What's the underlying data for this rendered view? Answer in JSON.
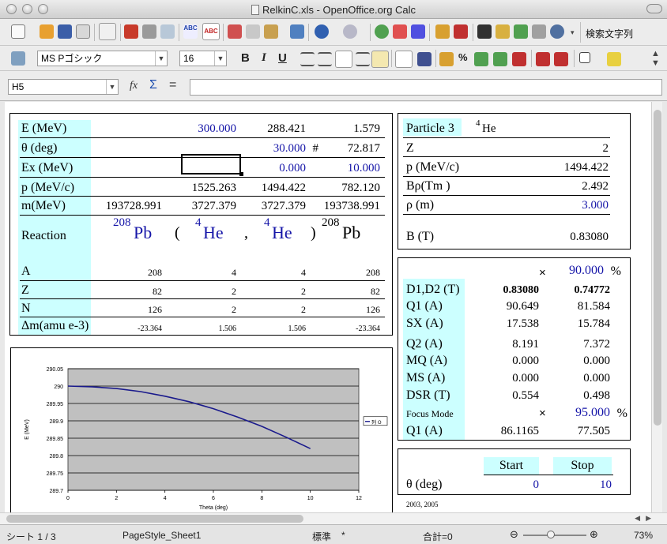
{
  "window": {
    "title": "RelkinC.xls - OpenOffice.org Calc"
  },
  "toolbar": {
    "font_name": "MS Pゴシック",
    "font_size": "16",
    "find_text": "検索文字列",
    "bold": "B",
    "italic": "I",
    "underline": "U"
  },
  "formula_bar": {
    "cell_ref": "H5",
    "content": ""
  },
  "kinematics": {
    "rows": [
      {
        "label": "E (MeV)",
        "c1": "",
        "c2": "300.000",
        "c3": "288.421",
        "c4": "1.579"
      },
      {
        "label": "θ (deg)",
        "c1": "",
        "c2": "",
        "c3": "30.000",
        "c3b": "#",
        "c4": "72.817"
      },
      {
        "label": "Ex (MeV)",
        "c1": "",
        "c2": "",
        "c3": "0.000",
        "c4": "10.000"
      },
      {
        "label": "p (MeV/c)",
        "c1": "",
        "c2": "1525.263",
        "c3": "1494.422",
        "c4": "782.120"
      },
      {
        "label": "m(MeV)",
        "c1": "193728.991",
        "c2": "3727.379",
        "c3": "3727.379",
        "c4": "193738.991"
      }
    ],
    "reaction": {
      "label": "Reaction",
      "target_mass": "208",
      "target": "Pb",
      "open": "(",
      "proj_mass": "4",
      "proj": "He",
      "comma": ",",
      "eject_mass": "4",
      "eject": "He",
      "close": ")",
      "resid_mass": "208",
      "resid": "Pb"
    },
    "nuc_rows": [
      {
        "label": "A",
        "values": [
          "208",
          "4",
          "4",
          "208"
        ]
      },
      {
        "label": "Z",
        "values": [
          "82",
          "2",
          "2",
          "82"
        ]
      },
      {
        "label": "N",
        "values": [
          "126",
          "2",
          "2",
          "126"
        ]
      },
      {
        "label": "Δm(amu e-3)",
        "values": [
          "-23.364",
          "1.506",
          "1.506",
          "-23.364"
        ]
      }
    ]
  },
  "particle": {
    "title": "Particle 3",
    "mass_number": "4",
    "symbol": "He",
    "rows": [
      {
        "label": "Z",
        "value": "2"
      },
      {
        "label": "p (MeV/c)",
        "value": "1494.422"
      },
      {
        "label": "Bρ(Tm )",
        "value": "2.492"
      },
      {
        "label": "ρ (m)",
        "value": "3.000"
      },
      {
        "label": "B (T)",
        "value": "0.83080"
      }
    ]
  },
  "magnets": {
    "scale1_symbol": "×",
    "scale1": "90.000",
    "scale1_unit": "%",
    "rows": [
      {
        "label": "D1,D2 (T)",
        "v1": "0.83080",
        "v2": "0.74772"
      },
      {
        "label": "Q1 (A)",
        "v1": "90.649",
        "v2": "81.584"
      },
      {
        "label": "SX (A)",
        "v1": "17.538",
        "v2": "15.784"
      },
      {
        "label": "Q2 (A)",
        "v1": "8.191",
        "v2": "7.372"
      },
      {
        "label": "MQ (A)",
        "v1": "0.000",
        "v2": "0.000"
      },
      {
        "label": "MS (A)",
        "v1": "0.000",
        "v2": "0.000"
      },
      {
        "label": "DSR (T)",
        "v1": "0.554",
        "v2": "0.498"
      }
    ],
    "focus_label": "Focus Mode",
    "scale2_symbol": "×",
    "scale2": "95.000",
    "scale2_unit": "%",
    "focus_row": {
      "label": "Q1 (A)",
      "v1": "86.1165",
      "v2": "77.505"
    }
  },
  "range": {
    "start_label": "Start",
    "stop_label": "Stop",
    "row_label": "θ (deg)",
    "start": "0",
    "stop": "10"
  },
  "footnote": "2003, 2005",
  "status": {
    "sheet": "シート 1 / 3",
    "page_style": "PageStyle_Sheet1",
    "mode": "標準",
    "modified": "*",
    "sum": "合計=0",
    "zoom": "73%"
  },
  "chart_data": {
    "type": "line",
    "title": "",
    "xlabel": "Theta (deg)",
    "ylabel": "E (MeV)",
    "xlim": [
      0,
      12
    ],
    "ylim": [
      289.7,
      290.05
    ],
    "x_ticks": [
      "0",
      "2",
      "4",
      "6",
      "8",
      "10",
      "12"
    ],
    "y_ticks": [
      "290.05",
      "290",
      "289.95",
      "289.9",
      "289.85",
      "289.8",
      "289.75",
      "289.7"
    ],
    "grid": true,
    "legend": "right",
    "series": [
      {
        "name": "列 O",
        "color": "#1a1a8c",
        "x": [
          0,
          1,
          2,
          3,
          4,
          5,
          6,
          7,
          8,
          9,
          10
        ],
        "y": [
          290.0,
          289.998,
          289.993,
          289.984,
          289.971,
          289.955,
          289.935,
          289.911,
          289.884,
          289.853,
          289.82
        ]
      }
    ]
  }
}
